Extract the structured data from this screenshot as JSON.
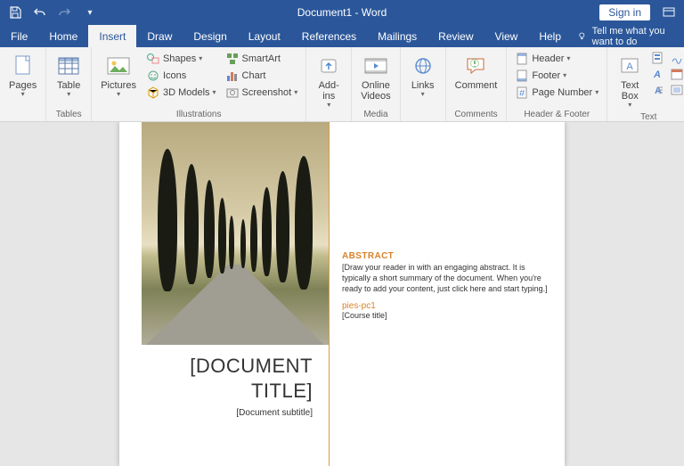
{
  "titlebar": {
    "document": "Document1 - Word",
    "signin": "Sign in"
  },
  "tabs": [
    "File",
    "Home",
    "Insert",
    "Draw",
    "Design",
    "Layout",
    "References",
    "Mailings",
    "Review",
    "View",
    "Help"
  ],
  "active_tab": "Insert",
  "tellme": "Tell me what you want to do",
  "ribbon": {
    "pages": {
      "label": "Pages"
    },
    "tables": {
      "btn": "Table",
      "label": "Tables"
    },
    "illustrations": {
      "pictures": "Pictures",
      "shapes": "Shapes",
      "icons": "Icons",
      "models": "3D Models",
      "smartart": "SmartArt",
      "chart": "Chart",
      "screenshot": "Screenshot",
      "label": "Illustrations"
    },
    "addins": {
      "btn": "Add-\nins",
      "label": ""
    },
    "media": {
      "btn": "Online\nVideos",
      "label": "Media"
    },
    "links": {
      "btn": "Links",
      "label": ""
    },
    "comments": {
      "btn": "Comment",
      "label": "Comments"
    },
    "headerfooter": {
      "header": "Header",
      "footer": "Footer",
      "pagenum": "Page Number",
      "label": "Header & Footer"
    },
    "text": {
      "textbox": "Text\nBox",
      "label": "Text"
    }
  },
  "doc": {
    "title": "[DOCUMENT TITLE]",
    "subtitle": "[Document subtitle]",
    "abstract_h": "ABSTRACT",
    "abstract": "[Draw your reader in with an engaging abstract. It is typically a short summary of the document. When you're ready to add your content, just click here and start typing.]",
    "author": "pies-pc1",
    "course": "[Course title]"
  }
}
